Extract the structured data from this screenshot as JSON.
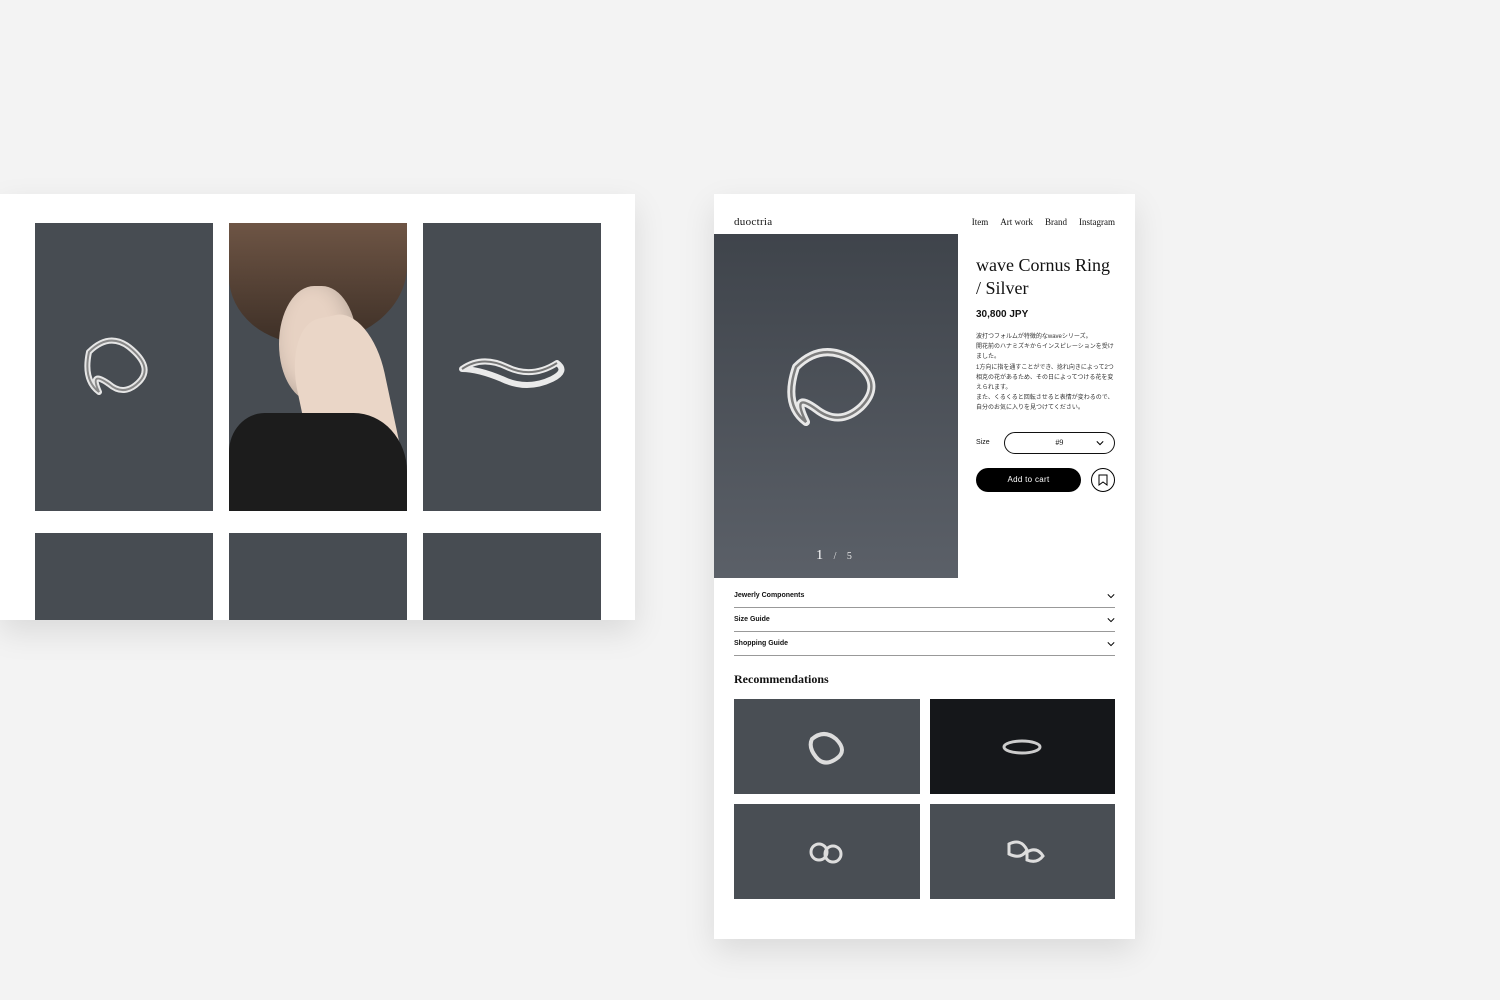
{
  "product_page": {
    "brand": "duoctria",
    "nav": {
      "item": "Item",
      "artwork": "Art work",
      "brand": "Brand",
      "instagram": "Instagram"
    },
    "title": "wave Cornus Ring / Silver",
    "price": "30,800 JPY",
    "description": "波打つフォルムが特徴的なwaveシリーズ。\n開花前のハナミズキからインスピレーションを受けました。\n1方向に指を通すことができ、捻れ向きによって2つ相克の花があるため、その日によってつける花を変えられます。\nまた、くるくると回転させると表情が変わるので、自分のお気に入りを見つけてください。",
    "size_label": "Size",
    "size_value": "#9",
    "add_to_cart": "Add to cart",
    "hero_counter": {
      "current": "1",
      "separator": "/",
      "total": "5"
    },
    "accordions": {
      "components": "Jewerly Components",
      "size_guide": "Size Guide",
      "shopping_guide": "Shopping Guide"
    },
    "recommendations_title": "Recommendations"
  }
}
